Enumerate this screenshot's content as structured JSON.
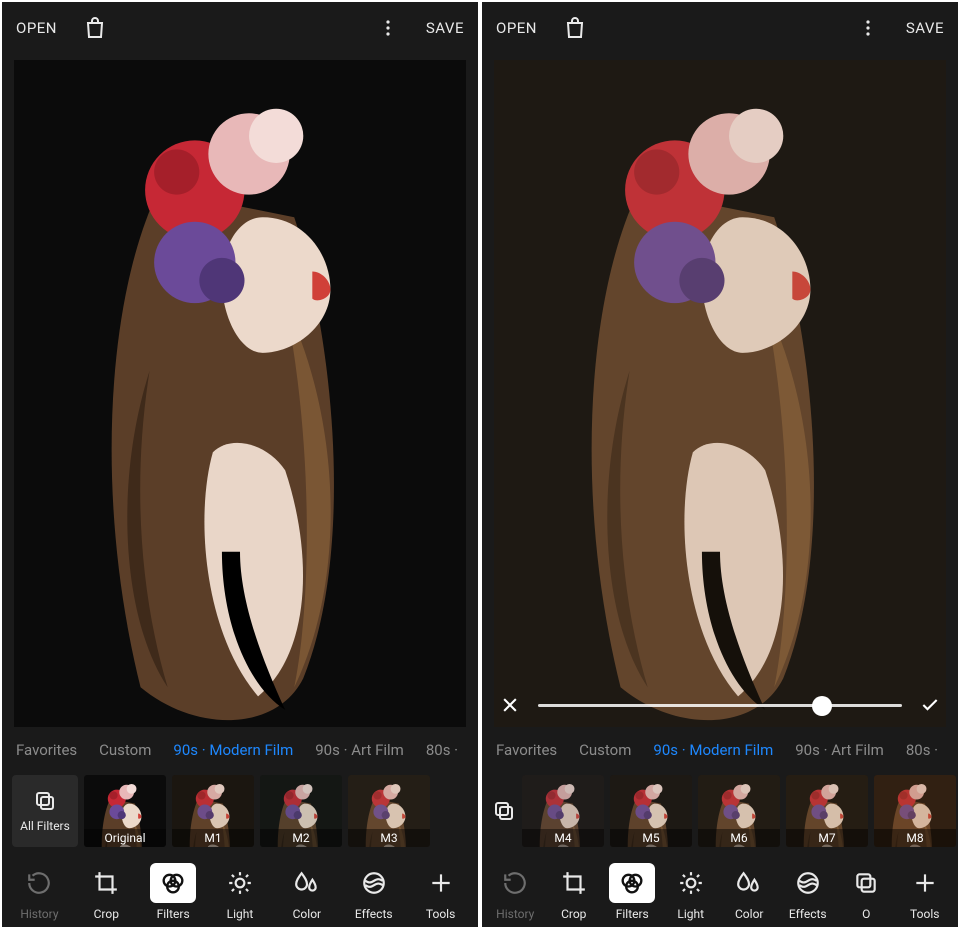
{
  "colors": {
    "accent": "#1e88ff",
    "bg": "#1a1a1a"
  },
  "topbar": {
    "open": "OPEN",
    "save": "SAVE"
  },
  "categories": {
    "items": [
      "Favorites",
      "Custom",
      "90s · Modern Film",
      "90s · Art Film",
      "80s ·"
    ],
    "active": "90s · Modern Film"
  },
  "left": {
    "all_filters": "All Filters",
    "thumbs": [
      {
        "label": "Original"
      },
      {
        "label": "M1"
      },
      {
        "label": "M2"
      },
      {
        "label": "M3"
      }
    ],
    "slider_visible": false
  },
  "right": {
    "thumbs": [
      {
        "label": "M4"
      },
      {
        "label": "M5"
      },
      {
        "label": "M6"
      },
      {
        "label": "M7"
      },
      {
        "label": "M8"
      }
    ],
    "slider_visible": true,
    "slider_position": 0.78
  },
  "bottom": {
    "history": "History",
    "crop": "Crop",
    "filters": "Filters",
    "light": "Light",
    "color": "Color",
    "effects": "Effects",
    "overlays_left": "O",
    "tools": "Tools",
    "active": "Filters"
  }
}
